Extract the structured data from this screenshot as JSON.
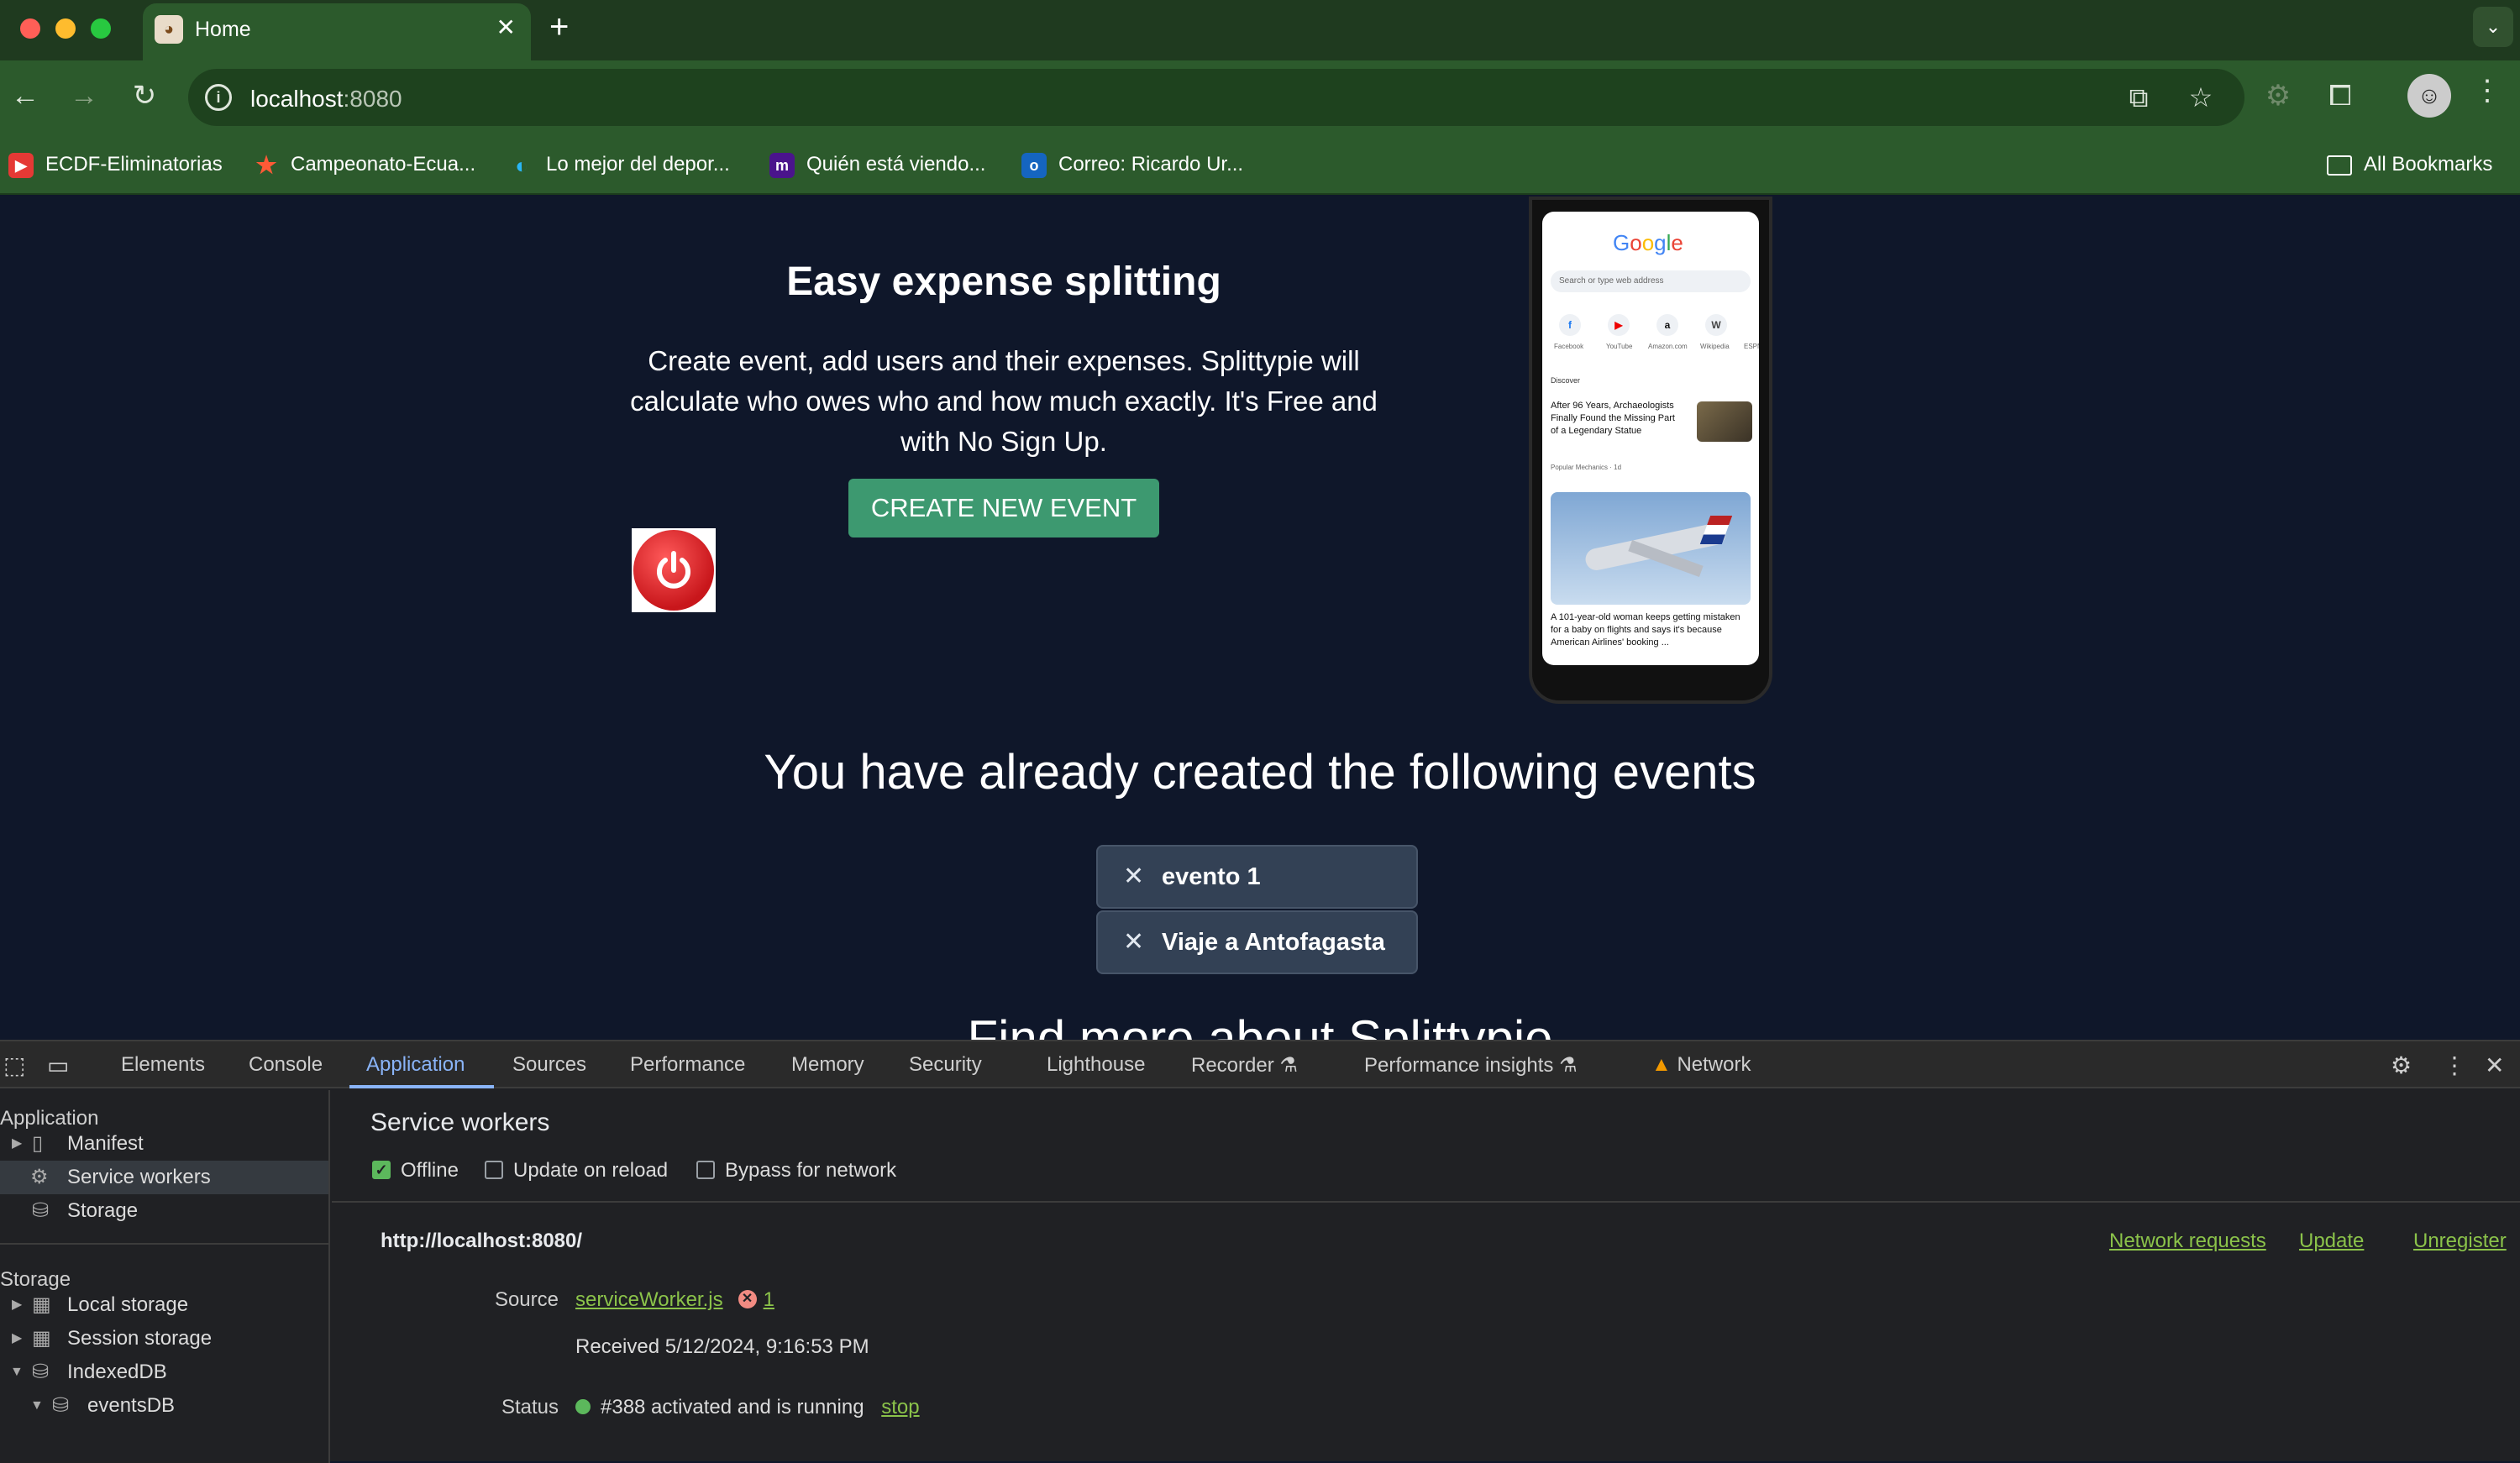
{
  "browser": {
    "tab_title": "Home",
    "url_host": "localhost",
    "url_port": ":8080",
    "bookmarks": [
      {
        "label": "ECDF-Eliminatorias",
        "color": "#e53935",
        "glyph": "▶"
      },
      {
        "label": "Campeonato-Ecua...",
        "color": "#e64a19",
        "glyph": "★"
      },
      {
        "label": "Lo mejor del depor...",
        "color": "#1e88e5",
        "glyph": "◐"
      },
      {
        "label": "Quién está viendo...",
        "color": "#4a148c",
        "glyph": "m"
      },
      {
        "label": "Correo: Ricardo Ur...",
        "color": "#1565c0",
        "glyph": "o"
      }
    ],
    "all_bookmarks_label": "All Bookmarks"
  },
  "page": {
    "hero_title": "Easy expense splitting",
    "hero_description": "Create event, add users and their expenses. Splittypie will calculate who owes who and how much exactly. It's Free and with No Sign Up.",
    "create_button": "CREATE NEW EVENT",
    "events_heading": "You have already created the following events",
    "events": [
      "evento 1",
      "Viaje a Antofagasta"
    ],
    "find_more": "Find more about Splittypie",
    "phone": {
      "search_placeholder": "Search or type web address",
      "shortcuts": [
        "Facebook",
        "YouTube",
        "Amazon.com",
        "Wikipedia",
        "ESPN"
      ],
      "discover": "Discover",
      "story1": "After 96 Years, Archaeologists Finally Found the Missing Part of a Legendary Statue",
      "story1_meta": "Popular Mechanics · 1d",
      "story2": "A 101-year-old woman keeps getting mistaken for a baby on flights and says it's because American Airlines' booking ..."
    }
  },
  "devtools": {
    "tabs": [
      "Elements",
      "Console",
      "Application",
      "Sources",
      "Performance",
      "Memory",
      "Security",
      "Lighthouse",
      "Recorder",
      "Performance insights",
      "Network"
    ],
    "active_tab": "Application",
    "sidebar": {
      "application_heading": "Application",
      "application_items": [
        "Manifest",
        "Service workers",
        "Storage"
      ],
      "storage_heading": "Storage",
      "storage_items": [
        "Local storage",
        "Session storage",
        "IndexedDB",
        "eventsDB"
      ]
    },
    "service_workers": {
      "title": "Service workers",
      "options": [
        {
          "label": "Offline",
          "checked": true
        },
        {
          "label": "Update on reload",
          "checked": false
        },
        {
          "label": "Bypass for network",
          "checked": false
        }
      ],
      "origin": "http://localhost:8080/",
      "links": [
        "Network requests",
        "Update",
        "Unregister"
      ],
      "source_label": "Source",
      "source_file": "serviceWorker.js",
      "error_count": "1",
      "received": "Received 5/12/2024, 9:16:53 PM",
      "status_label": "Status",
      "status_text": "#388 activated and is running",
      "stop_label": "stop"
    }
  }
}
